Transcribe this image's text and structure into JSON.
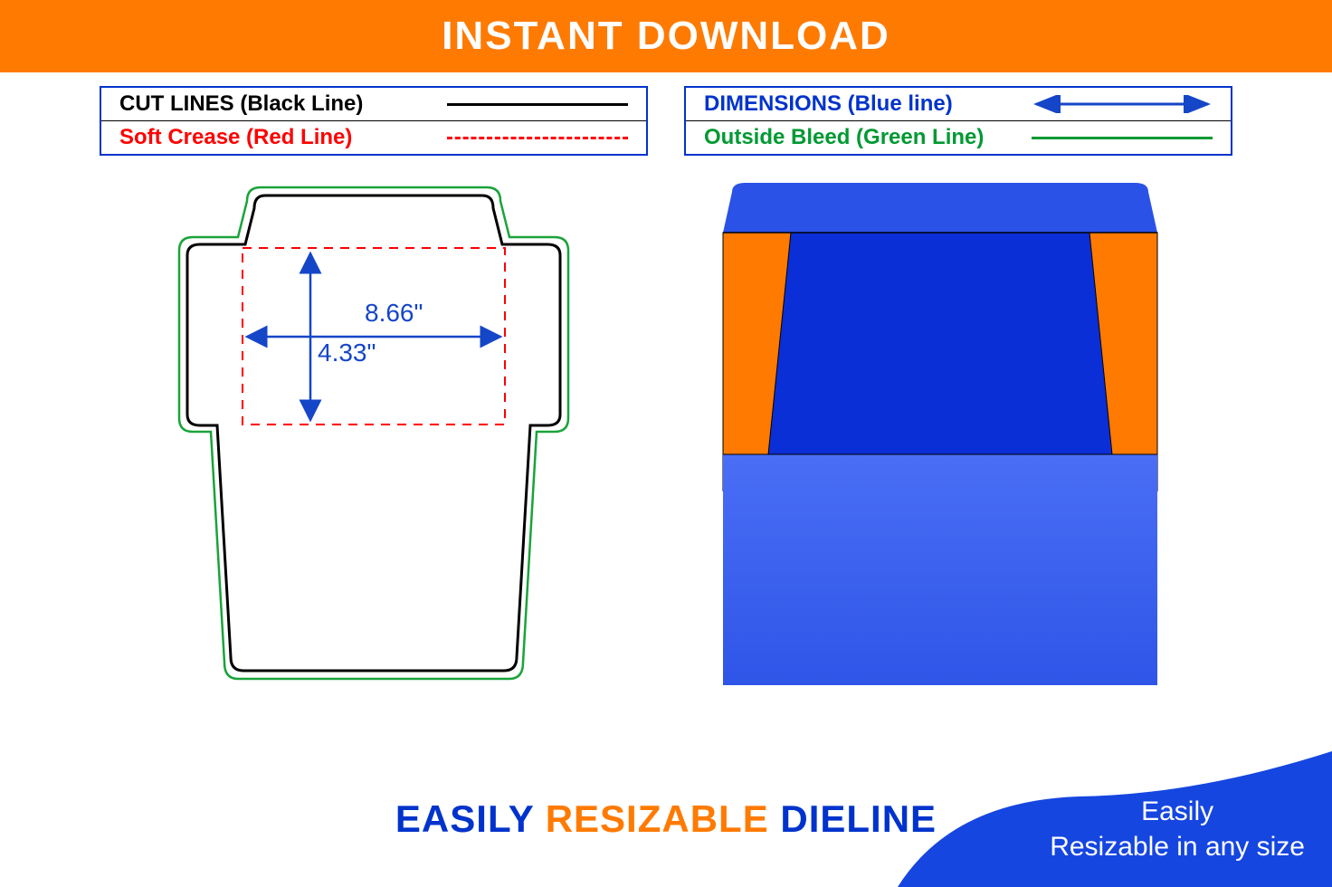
{
  "banner": {
    "title": "INSTANT DOWNLOAD"
  },
  "legend": {
    "left": [
      {
        "label": "CUT LINES (Black Line)",
        "style": "solid-black",
        "color": "cl-black"
      },
      {
        "label": "Soft Crease (Red Line)",
        "style": "dashed-red",
        "color": "cl-red"
      }
    ],
    "right": [
      {
        "label": "DIMENSIONS (Blue line)",
        "style": "arrow-blue",
        "color": "cl-blue"
      },
      {
        "label": "Outside Bleed (Green Line)",
        "style": "solid-green",
        "color": "cl-green"
      }
    ]
  },
  "dimensions": {
    "width_label": "8.66\"",
    "height_label": "4.33\""
  },
  "bottom_text": {
    "w1": "EASILY",
    "w2": "RESIZABLE",
    "w3": "DIELINE"
  },
  "corner": {
    "line1": "Easily",
    "line2": "Resizable in any size"
  },
  "chart_data": {
    "type": "diagram",
    "description": "Envelope dieline template with dimension callouts and a blue/orange 3D mockup.",
    "dimensions_inches": {
      "width": 8.66,
      "height": 4.33
    },
    "line_legend": {
      "cut_lines": "black solid",
      "soft_crease": "red dashed",
      "dimensions": "blue arrow",
      "outside_bleed": "green solid"
    },
    "colors": {
      "banner_orange": "#ff7a00",
      "dimension_blue": "#1546c8",
      "mockup_blue_light": "#3a62f0",
      "mockup_blue_dark": "#0b2fd6",
      "mockup_inner_orange": "#ff7a00"
    }
  }
}
